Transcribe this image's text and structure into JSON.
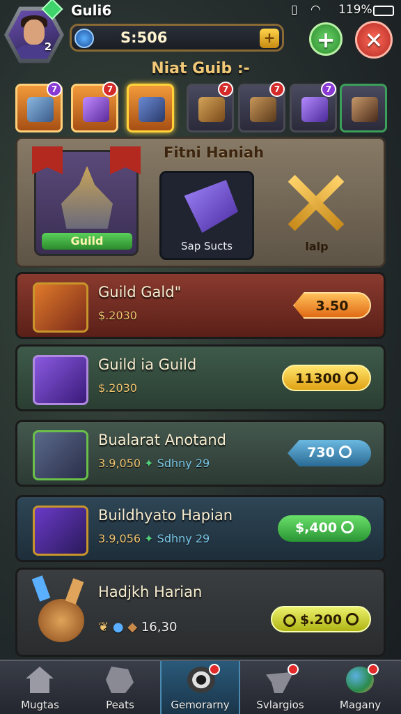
{
  "status_bar": {
    "carrier": "",
    "battery": "119%"
  },
  "player": {
    "name": "Guli6",
    "level": "2",
    "currency": "S:506"
  },
  "buttons": {
    "add": "+",
    "close": "✕"
  },
  "section_title": "Niat Guib :-",
  "tabs": [
    {
      "icon": "cannon-icon",
      "badge": "7",
      "badge_color": "purple"
    },
    {
      "icon": "drill-icon",
      "badge": "7",
      "badge_color": "red"
    },
    {
      "icon": "turret-icon",
      "badge": "",
      "badge_color": ""
    },
    {
      "icon": "chest-icon",
      "badge": "7",
      "badge_color": "red"
    },
    {
      "icon": "catapult-icon",
      "badge": "7",
      "badge_color": "red"
    },
    {
      "icon": "crystal-icon",
      "badge": "7",
      "badge_color": "purple"
    },
    {
      "icon": "hammer-icon",
      "badge": "",
      "badge_color": ""
    }
  ],
  "featured": {
    "title": "Fitni Haniah",
    "cards": [
      {
        "label": "Guild",
        "icon": "forge-tower-icon"
      },
      {
        "label": "Sap Sucts",
        "icon": "rune-crystal-icon"
      },
      {
        "label": "lalp",
        "icon": "crossed-arrows-icon"
      }
    ]
  },
  "offers": [
    {
      "name": "Guild Gald\"",
      "sub_a": "$.2030",
      "sub_arrow": "",
      "sub_b": "",
      "price": "3.50",
      "style": "orange",
      "icon": "crystal-sword-icon"
    },
    {
      "name": "Guild ia Guild",
      "sub_a": "$.2030",
      "sub_arrow": "",
      "sub_b": "",
      "price": "11300",
      "style": "yellow",
      "icon": "drill-cannon-icon"
    },
    {
      "name": "Bualarat Anotand",
      "sub_a": "3.9,050",
      "sub_arrow": "✦",
      "sub_b": "Sdhny 29",
      "price": "730",
      "style": "blue",
      "icon": "lance-icon"
    },
    {
      "name": "Buildhyato Hapian",
      "sub_a": "3.9,056",
      "sub_arrow": "✦",
      "sub_b": "Sdhny 29",
      "price": "$,400",
      "style": "green",
      "icon": "staff-icon"
    },
    {
      "name": "Hadjkh Harian",
      "sub_a": "16,30",
      "sub_arrow": "",
      "sub_b": "",
      "price": "$.200",
      "style": "lime",
      "icon": "shield-crest-icon"
    }
  ],
  "nav": [
    {
      "label": "Mugtas",
      "icon": "home-icon",
      "badge": false,
      "active": false
    },
    {
      "label": "Peats",
      "icon": "helmet-icon",
      "badge": false,
      "active": false
    },
    {
      "label": "Gemorarny",
      "icon": "target-icon",
      "badge": true,
      "active": true
    },
    {
      "label": "Svlargios",
      "icon": "anvil-icon",
      "badge": true,
      "active": false
    },
    {
      "label": "Magany",
      "icon": "globe-icon",
      "badge": true,
      "active": false
    }
  ]
}
